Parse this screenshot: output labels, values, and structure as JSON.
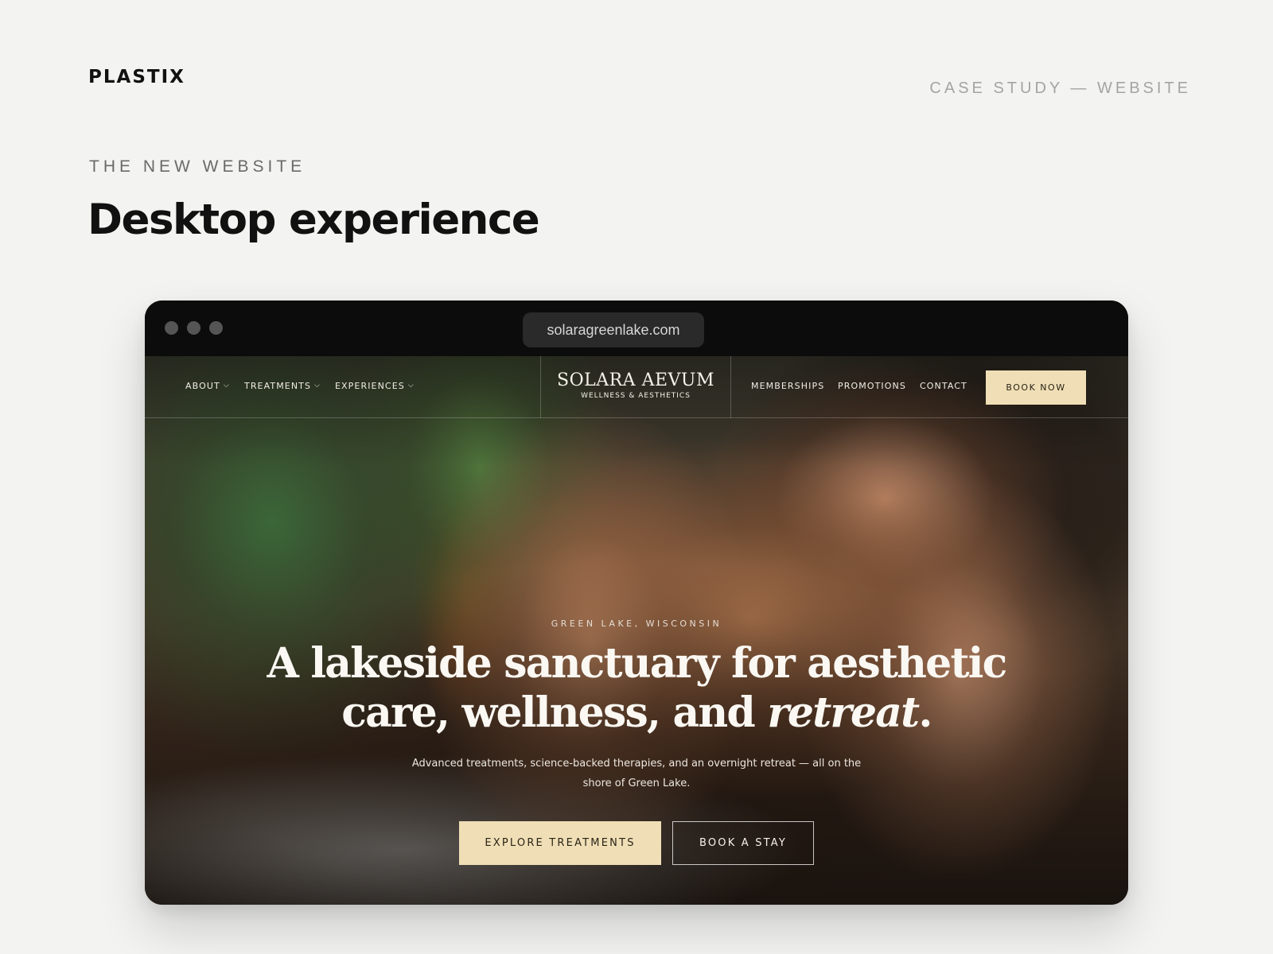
{
  "case_study": {
    "logo": "PLASTIX",
    "label": "CASE STUDY — WEBSITE",
    "eyebrow": "THE NEW WEBSITE",
    "title": "Desktop experience"
  },
  "browser": {
    "url": "solaragreenlake.com"
  },
  "site": {
    "nav_left": [
      {
        "label": "ABOUT",
        "icon": "chevron-down-icon"
      },
      {
        "label": "TREATMENTS",
        "icon": "chevron-down-icon"
      },
      {
        "label": "EXPERIENCES",
        "icon": "chevron-down-icon"
      }
    ],
    "brand": {
      "name": "SOLARA AEVUM",
      "tagline": "WELLNESS & AESTHETICS"
    },
    "nav_right": [
      "MEMBERSHIPS",
      "PROMOTIONS",
      "CONTACT"
    ],
    "book_now": "BOOK NOW",
    "hero": {
      "location": "GREEN LAKE, WISCONSIN",
      "headline_line1": "A lakeside sanctuary for aesthetic",
      "headline_line2": "care, wellness, and",
      "headline_italic": "retreat",
      "headline_end": ".",
      "subtext": "Advanced treatments, science-backed therapies, and an overnight retreat — all on the shore of Green Lake.",
      "cta_primary": "EXPLORE TREATMENTS",
      "cta_secondary": "BOOK A STAY",
      "image": "spa-facial-massage-photo"
    },
    "colors": {
      "accent": "#f0dfb6",
      "chrome": "#0c0c0c",
      "page_bg": "#f3f3f1"
    }
  }
}
